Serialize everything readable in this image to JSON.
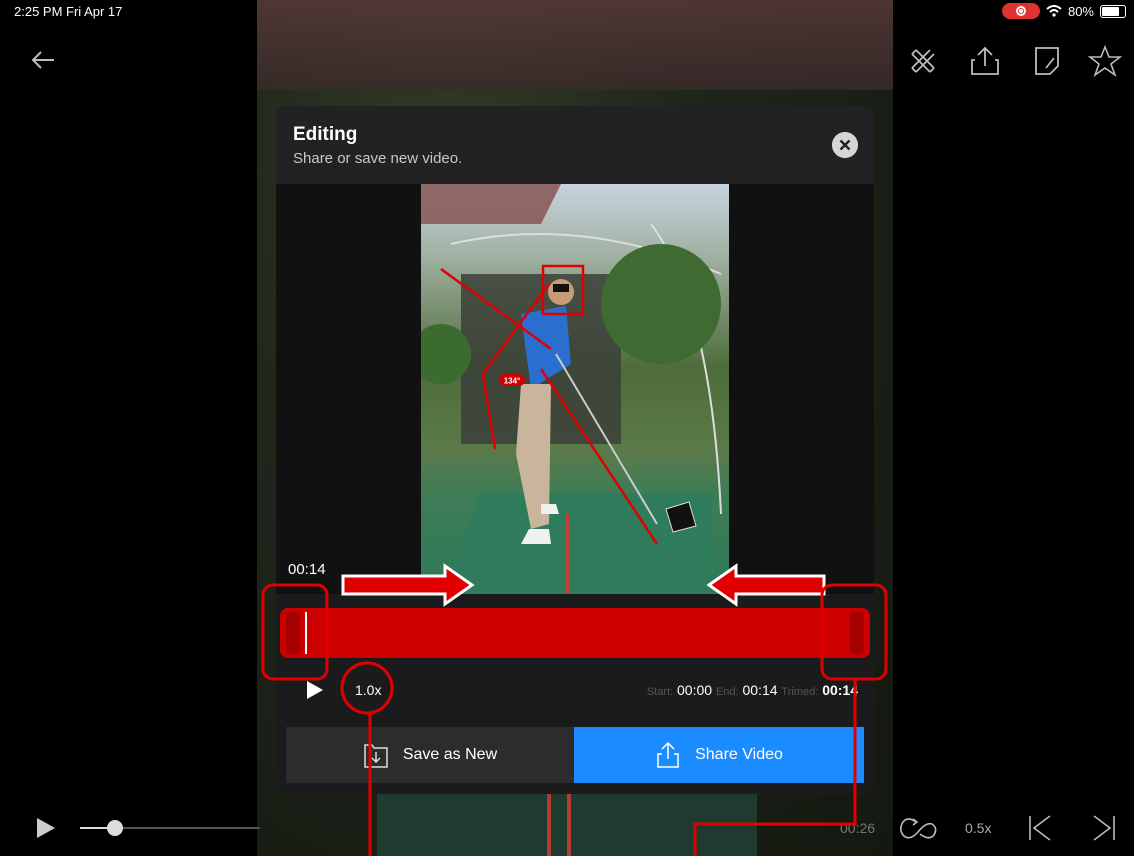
{
  "status_bar": {
    "time": "2:25 PM  Fri Apr 17",
    "battery": "80%"
  },
  "icons": {
    "back": "back-arrow-icon",
    "markup": "drawing-tools-icon",
    "share": "share-icon",
    "note": "note-icon",
    "favorite": "star-icon"
  },
  "modal": {
    "title": "Editing",
    "subtitle": "Share or save new video.",
    "current_time": "00:14",
    "speed": "1.0x",
    "trim": {
      "start_label": "Start:",
      "start_value": "00:00",
      "end_label": "End:",
      "end_value": "00:14",
      "trimmed_label": "Trimed:",
      "trimmed_value": "00:14"
    },
    "save_button": "Save as New",
    "share_button": "Share Video",
    "angle_badge": "134°"
  },
  "player": {
    "duration": "00:26",
    "rate": "0.5x",
    "progress_fraction": 0.15
  },
  "colors": {
    "accent_blue": "#1a8cff",
    "trim_red": "#cc0000",
    "annotation_red": "#e00000"
  }
}
